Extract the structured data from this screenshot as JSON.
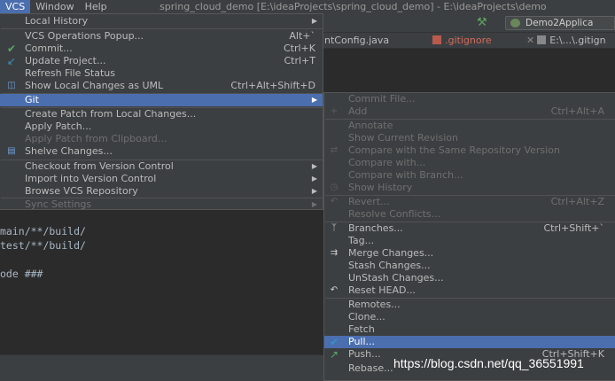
{
  "menubar": {
    "items": [
      "VCS",
      "Window",
      "Help"
    ],
    "window_title": "spring_cloud_demo [E:\\ideaProjects\\spring_cloud_demo] - E:\\ideaProjects\\demo"
  },
  "toolbar": {
    "run_config": "Demo2Applica"
  },
  "tabs": [
    {
      "label": "ntConfig.java"
    },
    {
      "label": ".gitignore"
    },
    {
      "label": "E:\\...\\.gitign"
    }
  ],
  "editor": {
    "lines": [
      "main/**/build/",
      "test/**/build/",
      "",
      "ode ###"
    ]
  },
  "vcs_menu": {
    "items": [
      {
        "label": "Local History",
        "shortcut": "",
        "submenu": true,
        "disabled": false,
        "icon": ""
      },
      {
        "label": "VCS Operations Popup...",
        "shortcut": "Alt+`",
        "submenu": false,
        "disabled": false,
        "icon": ""
      },
      {
        "label": "Commit...",
        "shortcut": "Ctrl+K",
        "submenu": false,
        "disabled": false,
        "icon": "check-icon"
      },
      {
        "label": "Update Project...",
        "shortcut": "Ctrl+T",
        "submenu": false,
        "disabled": false,
        "icon": "update-arrow-icon"
      },
      {
        "label": "Refresh File Status",
        "shortcut": "",
        "submenu": false,
        "disabled": false,
        "icon": ""
      },
      {
        "label": "Show Local Changes as UML",
        "shortcut": "Ctrl+Alt+Shift+D",
        "submenu": false,
        "disabled": false,
        "icon": "uml-icon"
      },
      {
        "label": "Git",
        "shortcut": "",
        "submenu": true,
        "disabled": false,
        "icon": "",
        "selected": true
      },
      {
        "label": "Create Patch from Local Changes...",
        "shortcut": "",
        "submenu": false,
        "disabled": false,
        "icon": ""
      },
      {
        "label": "Apply Patch...",
        "shortcut": "",
        "submenu": false,
        "disabled": false,
        "icon": ""
      },
      {
        "label": "Apply Patch from Clipboard...",
        "shortcut": "",
        "submenu": false,
        "disabled": true,
        "icon": ""
      },
      {
        "label": "Shelve Changes...",
        "shortcut": "",
        "submenu": false,
        "disabled": false,
        "icon": "shelve-icon"
      },
      {
        "label": "Checkout from Version Control",
        "shortcut": "",
        "submenu": true,
        "disabled": false,
        "icon": ""
      },
      {
        "label": "Import into Version Control",
        "shortcut": "",
        "submenu": true,
        "disabled": false,
        "icon": ""
      },
      {
        "label": "Browse VCS Repository",
        "shortcut": "",
        "submenu": true,
        "disabled": false,
        "icon": ""
      },
      {
        "label": "Sync Settings",
        "shortcut": "",
        "submenu": true,
        "disabled": true,
        "icon": ""
      }
    ]
  },
  "git_menu": {
    "items": [
      {
        "label": "Commit File...",
        "shortcut": "",
        "disabled": true,
        "icon": ""
      },
      {
        "label": "Add",
        "shortcut": "Ctrl+Alt+A",
        "disabled": true,
        "icon": "plus-icon"
      },
      {
        "label": "Annotate",
        "shortcut": "",
        "disabled": true,
        "icon": ""
      },
      {
        "label": "Show Current Revision",
        "shortcut": "",
        "disabled": true,
        "icon": ""
      },
      {
        "label": "Compare with the Same Repository Version",
        "shortcut": "",
        "disabled": true,
        "icon": "compare-icon"
      },
      {
        "label": "Compare with...",
        "shortcut": "",
        "disabled": true,
        "icon": ""
      },
      {
        "label": "Compare with Branch...",
        "shortcut": "",
        "disabled": true,
        "icon": ""
      },
      {
        "label": "Show History",
        "shortcut": "",
        "disabled": true,
        "icon": "history-icon"
      },
      {
        "label": "Revert...",
        "shortcut": "Ctrl+Alt+Z",
        "disabled": true,
        "icon": "revert-icon"
      },
      {
        "label": "Resolve Conflicts...",
        "shortcut": "",
        "disabled": true,
        "icon": ""
      },
      {
        "label": "Branches...",
        "shortcut": "Ctrl+Shift+`",
        "disabled": false,
        "icon": "branch-icon"
      },
      {
        "label": "Tag...",
        "shortcut": "",
        "disabled": false,
        "icon": ""
      },
      {
        "label": "Merge Changes...",
        "shortcut": "",
        "disabled": false,
        "icon": "merge-icon"
      },
      {
        "label": "Stash Changes...",
        "shortcut": "",
        "disabled": false,
        "icon": ""
      },
      {
        "label": "UnStash Changes...",
        "shortcut": "",
        "disabled": false,
        "icon": ""
      },
      {
        "label": "Reset HEAD...",
        "shortcut": "",
        "disabled": false,
        "icon": "reset-icon"
      },
      {
        "label": "Remotes...",
        "shortcut": "",
        "disabled": false,
        "icon": ""
      },
      {
        "label": "Clone...",
        "shortcut": "",
        "disabled": false,
        "icon": ""
      },
      {
        "label": "Fetch",
        "shortcut": "",
        "disabled": false,
        "icon": ""
      },
      {
        "label": "Pull...",
        "shortcut": "",
        "disabled": false,
        "icon": "pull-icon",
        "selected": true
      },
      {
        "label": "Push...",
        "shortcut": "Ctrl+Shift+K",
        "disabled": false,
        "icon": "push-icon"
      },
      {
        "label": "Rebase...",
        "shortcut": "",
        "disabled": false,
        "icon": ""
      }
    ]
  },
  "watermark": "https://blog.csdn.net/qq_36551991",
  "colors": {
    "selection": "#4b6eaf",
    "menu_bg": "#3c3f41",
    "editor_bg": "#2b2b2b",
    "check_green": "#59a869",
    "update_blue": "#3592c4"
  }
}
